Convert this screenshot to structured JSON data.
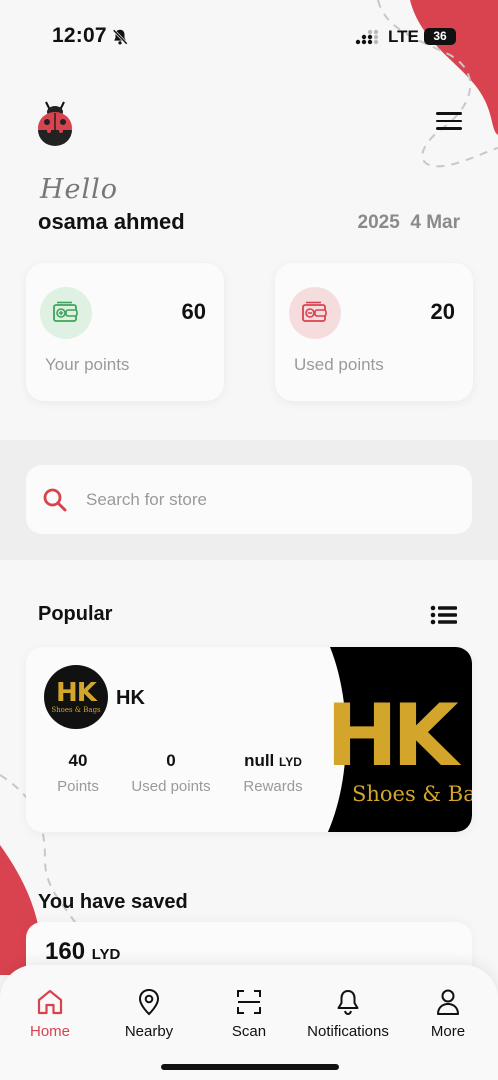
{
  "status_bar": {
    "time": "12:07",
    "network": "LTE",
    "battery": "36"
  },
  "header": {
    "greeting": "Hello",
    "user_name": "osama ahmed",
    "date_year": "2025",
    "date_day_month": "4 Mar"
  },
  "points": [
    {
      "value": "60",
      "label": "Your points"
    },
    {
      "value": "20",
      "label": "Used points"
    }
  ],
  "search": {
    "placeholder": "Search for store"
  },
  "popular": {
    "title": "Popular",
    "store": {
      "name": "HK",
      "logo_text": "HK",
      "logo_subtext": "Shoes & Bags",
      "stats": [
        {
          "value": "40",
          "unit": "",
          "label": "Points"
        },
        {
          "value": "0",
          "unit": "",
          "label": "Used points"
        },
        {
          "value": "null",
          "unit": "LYD",
          "label": "Rewards"
        }
      ]
    }
  },
  "saved": {
    "title": "You have saved",
    "value": "160",
    "unit": "LYD"
  },
  "nav": [
    {
      "label": "Home",
      "icon": "home-icon",
      "active": true
    },
    {
      "label": "Nearby",
      "icon": "location-pin-icon",
      "active": false
    },
    {
      "label": "Scan",
      "icon": "scan-icon",
      "active": false
    },
    {
      "label": "Notifications",
      "icon": "bell-icon",
      "active": false
    },
    {
      "label": "More",
      "icon": "user-icon",
      "active": false
    }
  ],
  "colors": {
    "accent": "#d9434f",
    "background": "#f7f7f7",
    "card": "#fbfbfb",
    "gold": "#d4a52b",
    "green_icon": "#3fa35a"
  }
}
